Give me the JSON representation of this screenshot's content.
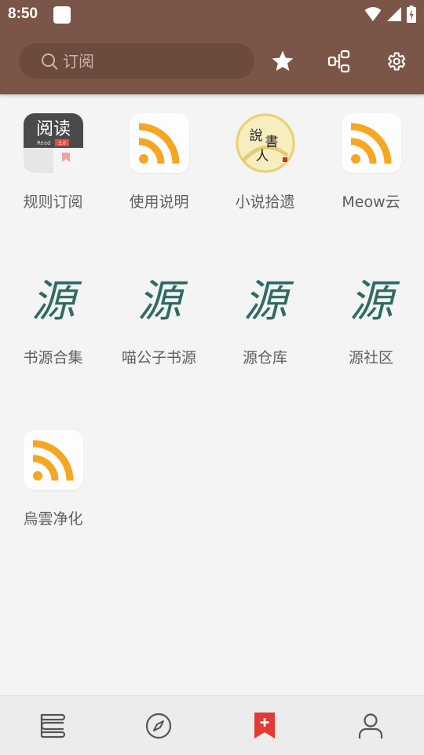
{
  "status_bar": {
    "time": "8:50",
    "icons": [
      "app-notification-icon",
      "wifi-icon",
      "cell-signal-icon",
      "battery-charging-icon"
    ]
  },
  "app_bar": {
    "background": "#7b5547",
    "search": {
      "placeholder": "订阅",
      "value": ""
    },
    "actions": [
      "star-icon",
      "group-icon",
      "gear-icon"
    ]
  },
  "sources": [
    {
      "label": "规则订阅",
      "icon": "read-app-icon"
    },
    {
      "label": "使用说明",
      "icon": "rss-icon"
    },
    {
      "label": "小说拾遗",
      "icon": "shuo-shu-ren-icon"
    },
    {
      "label": "Meow云",
      "icon": "rss-icon"
    },
    {
      "label": "书源合集",
      "icon": "yuan-calligraphy-icon"
    },
    {
      "label": "喵公子书源",
      "icon": "yuan-calligraphy-icon"
    },
    {
      "label": "源仓库",
      "icon": "yuan-calligraphy-icon"
    },
    {
      "label": "源社区",
      "icon": "yuan-calligraphy-icon"
    },
    {
      "label": "烏雲净化",
      "icon": "rss-icon"
    }
  ],
  "read_icon": {
    "title": "阅读",
    "sub": "Read",
    "badge": "3.0"
  },
  "shuoshu_icon": {
    "chars": "說書人"
  },
  "yuan_char": "源",
  "bottom_nav": {
    "items": [
      "bookshelf-icon",
      "compass-icon",
      "subscription-bookmark-icon",
      "profile-icon"
    ],
    "active_index": 2,
    "active_color": "#e53935"
  }
}
